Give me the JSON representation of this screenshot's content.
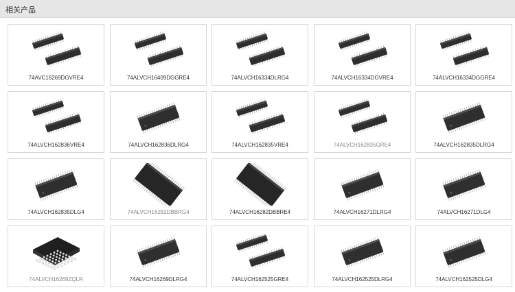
{
  "header": {
    "title": "相关产品"
  },
  "products": [
    {
      "name": "74AVC16269DGVRE4",
      "muted": false,
      "image": "tssop-pair-icon"
    },
    {
      "name": "74ALVCH16409DGGRE4",
      "muted": false,
      "image": "tssop-pair-icon"
    },
    {
      "name": "74ALVCH16334DLRG4",
      "muted": false,
      "image": "tssop-pair-icon"
    },
    {
      "name": "74ALVCH16334DGVRE4",
      "muted": false,
      "image": "tssop-pair-icon"
    },
    {
      "name": "74ALVCH16334DGGRE4",
      "muted": false,
      "image": "tssop-pair-icon"
    },
    {
      "name": "74ALVCH162836VRE4",
      "muted": false,
      "image": "tssop-pair-icon"
    },
    {
      "name": "74ALVCH162836DLRG4",
      "muted": false,
      "image": "ssop-chip-icon"
    },
    {
      "name": "74ALVCH162835VRE4",
      "muted": false,
      "image": "tssop-pair-icon"
    },
    {
      "name": "74ALVCH162835GRE4",
      "muted": true,
      "image": "tssop-pair-icon"
    },
    {
      "name": "74ALVCH162835DLRG4",
      "muted": false,
      "image": "ssop-chip-icon"
    },
    {
      "name": "74ALVCH162835DLG4",
      "muted": false,
      "image": "ssop-chip-icon"
    },
    {
      "name": "74ALVCH16282DBBRG4",
      "muted": true,
      "image": "tsop-large-icon"
    },
    {
      "name": "74ALVCH16282DBBRE4",
      "muted": false,
      "image": "tsop-large-icon"
    },
    {
      "name": "74ALVCH16271DLRG4",
      "muted": false,
      "image": "ssop-chip-icon"
    },
    {
      "name": "74ALVCH16271DLG4",
      "muted": false,
      "image": "ssop-chip-icon"
    },
    {
      "name": "74ALVCH16269ZQLR",
      "muted": true,
      "image": "bga-chip-icon"
    },
    {
      "name": "74ALVCH16269DLRG4",
      "muted": false,
      "image": "ssop-chip-icon"
    },
    {
      "name": "74ALVCH162525GRE4",
      "muted": false,
      "image": "tssop-pair-icon"
    },
    {
      "name": "74ALVCH162525DLRG4",
      "muted": false,
      "image": "ssop-chip-icon"
    },
    {
      "name": "74ALVCH162525DLG4",
      "muted": false,
      "image": "ssop-chip-icon"
    }
  ]
}
